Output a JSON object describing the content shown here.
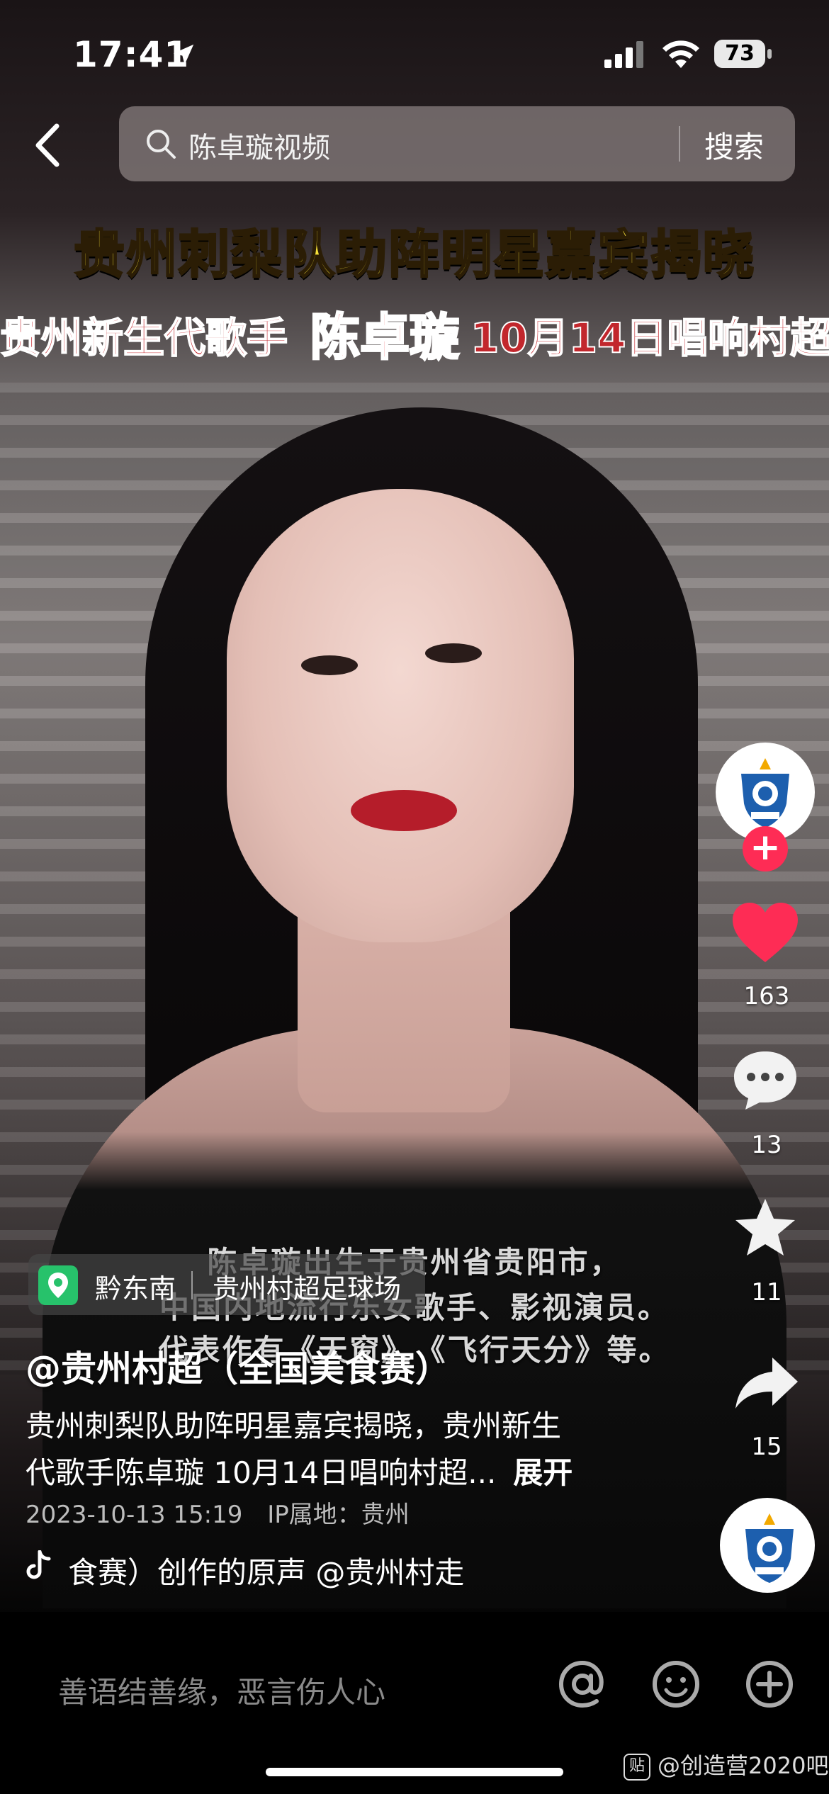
{
  "status_bar": {
    "time": "17:41",
    "battery": "73"
  },
  "search": {
    "query": "陈卓璇视频",
    "button_label": "搜索"
  },
  "video": {
    "banner_line1": "贵州刺梨队助阵明星嘉宾揭晓",
    "banner_line2_prefix": "贵州新生代歌手",
    "banner_line2_name": "陈卓璇",
    "banner_line2_suffix": "10月14日唱响村超",
    "captions": [
      "陈卓璇出生于贵州省贵阳市，",
      "中国内地流行乐女歌手、影视演员。",
      "代表作有《天窗》、《飞行天分》等。"
    ]
  },
  "location": {
    "region": "黔东南",
    "place": "贵州村超足球场"
  },
  "post": {
    "author": "@贵州村超（全国美食赛）",
    "desc_line1": "贵州刺梨队助阵明星嘉宾揭晓，贵州新生",
    "desc_line2": "代歌手陈卓璇 10月14日唱响村超...",
    "expand_label": "展开",
    "date": "2023-10-13 15:19",
    "ip": "IP属地：贵州",
    "music": "食赛）创作的原声    @贵州村走"
  },
  "actions": {
    "likes": "163",
    "comments": "13",
    "favorites": "11",
    "shares": "15",
    "follow_symbol": "+"
  },
  "comment_bar": {
    "placeholder": "善语结善缘，恶言伤人心"
  },
  "watermark": {
    "badge": "贴",
    "text": "@创造营2020吧"
  },
  "colors": {
    "like_red": "#fe2c55",
    "location_green": "#27c26b",
    "banner_yellow": "#f7e13a",
    "banner_red": "#c2272d"
  }
}
